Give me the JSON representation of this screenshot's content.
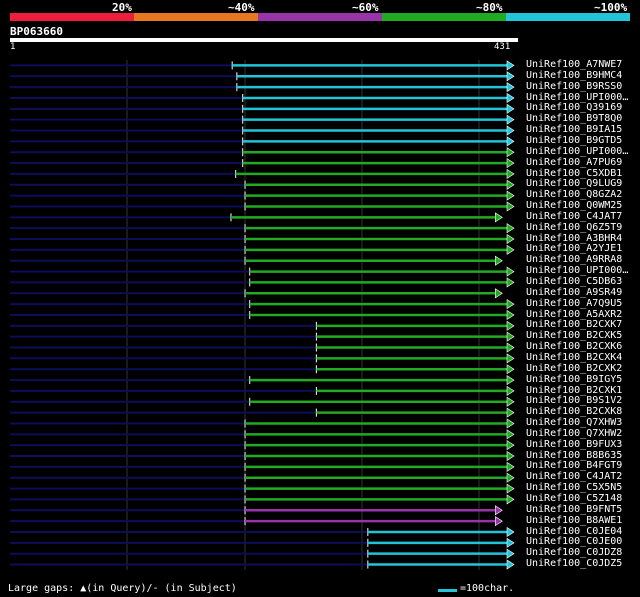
{
  "colors": {
    "background": "#000000",
    "red": "#ee1d3c",
    "orange": "#e87722",
    "purple": "#9933aa",
    "green": "#22aa22",
    "cyan": "#22c4d8",
    "gap": "#0d0d5a",
    "grid": "#333333"
  },
  "scale": {
    "labels": [
      "20%",
      "~40%",
      "~60%",
      "~80%",
      "~100%"
    ],
    "bands": [
      "red",
      "orange",
      "purple",
      "green",
      "cyan"
    ]
  },
  "query": {
    "id": "BP063660",
    "start": "1",
    "end": "431",
    "length": 431
  },
  "hits": [
    {
      "name": "UniRef100_A7NWE7",
      "start": 190,
      "color": "cyan"
    },
    {
      "name": "UniRef100_B9HMC4",
      "start": 194,
      "color": "cyan"
    },
    {
      "name": "UniRef100_B9RSS0",
      "start": 194,
      "color": "cyan"
    },
    {
      "name": "UniRef100_UPI000…",
      "start": 199,
      "color": "cyan"
    },
    {
      "name": "UniRef100_Q39169",
      "start": 199,
      "color": "cyan"
    },
    {
      "name": "UniRef100_B9T8Q0",
      "start": 199,
      "color": "cyan"
    },
    {
      "name": "UniRef100_B9IA15",
      "start": 199,
      "color": "cyan"
    },
    {
      "name": "UniRef100_B9GTD5",
      "start": 199,
      "color": "cyan"
    },
    {
      "name": "UniRef100_UPI000…",
      "start": 199,
      "color": "green"
    },
    {
      "name": "UniRef100_A7PU69",
      "start": 199,
      "color": "green"
    },
    {
      "name": "UniRef100_C5XDB1",
      "start": 193,
      "color": "green"
    },
    {
      "name": "UniRef100_Q9LUG9",
      "start": 201,
      "color": "green"
    },
    {
      "name": "UniRef100_Q8GZA2",
      "start": 201,
      "color": "green"
    },
    {
      "name": "UniRef100_Q0WM25",
      "start": 201,
      "color": "green"
    },
    {
      "name": "UniRef100_C4JAT7",
      "start": 189,
      "end": 421,
      "color": "green"
    },
    {
      "name": "UniRef100_Q6Z5T9",
      "start": 201,
      "color": "green"
    },
    {
      "name": "UniRef100_A3BHR4",
      "start": 201,
      "color": "green"
    },
    {
      "name": "UniRef100_A2YJE1",
      "start": 201,
      "color": "green"
    },
    {
      "name": "UniRef100_A9RRA8",
      "start": 201,
      "end": 421,
      "color": "green"
    },
    {
      "name": "UniRef100_UPI000…",
      "start": 205,
      "color": "green"
    },
    {
      "name": "UniRef100_C5DB63",
      "start": 205,
      "color": "green"
    },
    {
      "name": "UniRef100_A9SR49",
      "start": 201,
      "end": 421,
      "color": "green"
    },
    {
      "name": "UniRef100_A7Q9U5",
      "start": 205,
      "color": "green"
    },
    {
      "name": "UniRef100_A5AXR2",
      "start": 205,
      "color": "green"
    },
    {
      "name": "UniRef100_B2CXK7",
      "start": 262,
      "color": "green"
    },
    {
      "name": "UniRef100_B2CXK5",
      "start": 262,
      "color": "green"
    },
    {
      "name": "UniRef100_B2CXK6",
      "start": 262,
      "color": "green"
    },
    {
      "name": "UniRef100_B2CXK4",
      "start": 262,
      "color": "green"
    },
    {
      "name": "UniRef100_B2CXK2",
      "start": 262,
      "color": "green"
    },
    {
      "name": "UniRef100_B9IGY5",
      "start": 205,
      "color": "green"
    },
    {
      "name": "UniRef100_B2CXK1",
      "start": 262,
      "color": "green"
    },
    {
      "name": "UniRef100_B9S1V2",
      "start": 205,
      "color": "green"
    },
    {
      "name": "UniRef100_B2CXK8",
      "start": 262,
      "color": "green"
    },
    {
      "name": "UniRef100_Q7XHW3",
      "start": 201,
      "color": "green"
    },
    {
      "name": "UniRef100_Q7XHW2",
      "start": 201,
      "color": "green"
    },
    {
      "name": "UniRef100_B9FUX3",
      "start": 201,
      "color": "green"
    },
    {
      "name": "UniRef100_B8B635",
      "start": 201,
      "color": "green"
    },
    {
      "name": "UniRef100_B4FGT9",
      "start": 201,
      "color": "green"
    },
    {
      "name": "UniRef100_C4JAT2",
      "start": 201,
      "color": "green"
    },
    {
      "name": "UniRef100_C5X5N5",
      "start": 201,
      "color": "green"
    },
    {
      "name": "UniRef100_C5Z148",
      "start": 201,
      "color": "green"
    },
    {
      "name": "UniRef100_B9FNT5",
      "start": 201,
      "end": 421,
      "color": "purple"
    },
    {
      "name": "UniRef100_B8AWE1",
      "start": 201,
      "end": 421,
      "color": "purple"
    },
    {
      "name": "UniRef100_C0JE04",
      "start": 306,
      "color": "cyan"
    },
    {
      "name": "UniRef100_C0JE00",
      "start": 306,
      "color": "cyan"
    },
    {
      "name": "UniRef100_C0JDZ8",
      "start": 306,
      "color": "cyan"
    },
    {
      "name": "UniRef100_C0JDZ5",
      "start": 306,
      "color": "cyan"
    }
  ],
  "footer": {
    "text": "Large gaps: ▲(in Query)/- (in Subject)",
    "legend": "=100char."
  }
}
